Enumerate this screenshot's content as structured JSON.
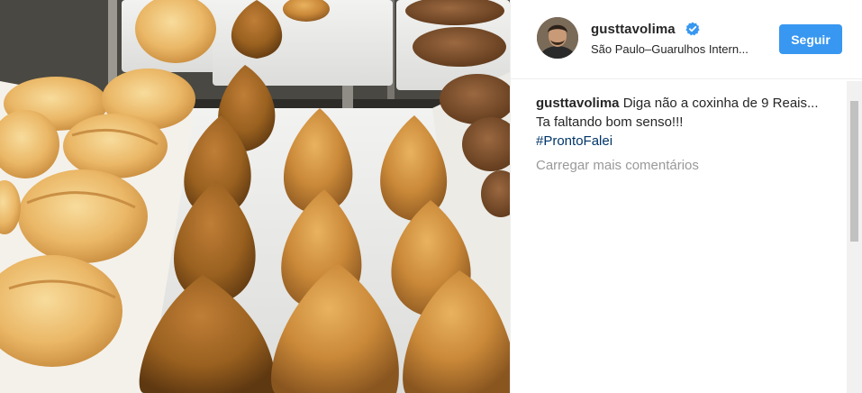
{
  "post": {
    "photo": {
      "icon": "photo-image",
      "description_visible": false
    },
    "header": {
      "username": "gusttavolima",
      "verified_icon": "verified-badge-icon",
      "location": "São Paulo–Guarulhos Intern...",
      "follow_label": "Seguir"
    },
    "caption": {
      "username": "gusttavolima",
      "text": "Diga não a coxinha de 9 Reais... Ta faltando bom senso!!!",
      "hashtag": "#ProntoFalei"
    },
    "load_more_label": "Carregar mais comentários",
    "colors": {
      "accent": "#3897f0",
      "hashtag": "#003569",
      "muted": "#999999",
      "text": "#262626"
    }
  }
}
